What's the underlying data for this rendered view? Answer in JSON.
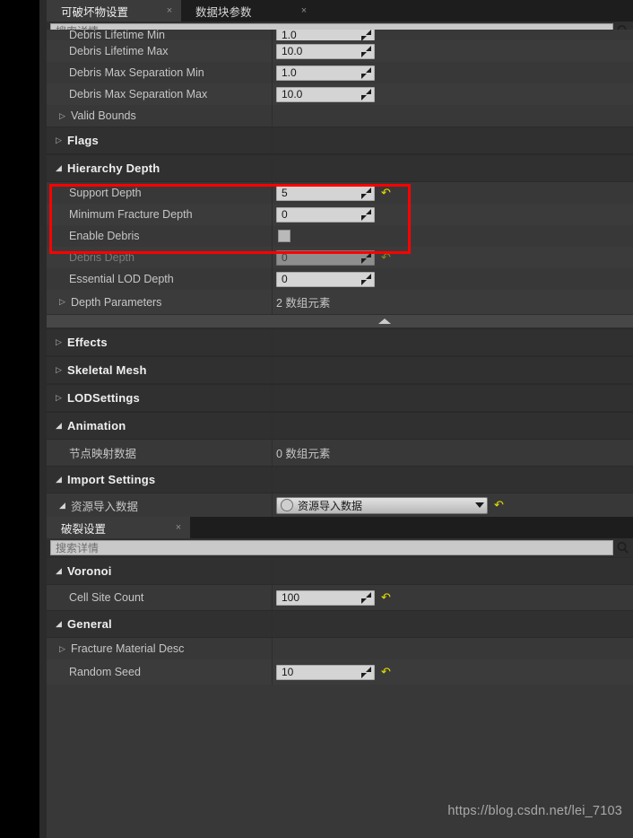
{
  "window": {
    "watermark": "https://blog.csdn.net/lei_7103"
  },
  "top_panel": {
    "tabs": [
      {
        "label": "可破坏物设置",
        "close": "×",
        "active": true
      },
      {
        "label": "数据块参数",
        "close": "×",
        "active": false
      }
    ],
    "search": {
      "placeholder": "搜索详情",
      "value": "",
      "icon": "search-icon"
    },
    "rows": [
      {
        "kind": "property",
        "clipped": true,
        "label": "Debris Lifetime Min",
        "value": "1.0",
        "control": "number",
        "reset": false,
        "disabled": false,
        "indent": true
      },
      {
        "kind": "property",
        "label": "Debris Lifetime Max",
        "value": "10.0",
        "control": "number",
        "reset": false,
        "disabled": false,
        "indent": true
      },
      {
        "kind": "property",
        "label": "Debris Max Separation Min",
        "value": "1.0",
        "control": "number",
        "reset": false,
        "disabled": false,
        "indent": true
      },
      {
        "kind": "property",
        "label": "Debris Max Separation Max",
        "value": "10.0",
        "control": "number",
        "reset": false,
        "disabled": false,
        "indent": true
      },
      {
        "kind": "expandable",
        "label": "Valid Bounds",
        "expander": "collapsed",
        "value": ""
      },
      {
        "kind": "section",
        "label": "Flags",
        "expander": "collapsed"
      },
      {
        "kind": "section",
        "label": "Hierarchy Depth",
        "expander": "expanded"
      },
      {
        "kind": "property",
        "label": "Support Depth",
        "value": "5",
        "control": "number",
        "reset": true,
        "disabled": false,
        "indent": true
      },
      {
        "kind": "property",
        "label": "Minimum Fracture Depth",
        "value": "0",
        "control": "number",
        "reset": false,
        "disabled": false,
        "indent": true
      },
      {
        "kind": "property",
        "label": "Enable Debris",
        "value": "",
        "control": "checkbox",
        "checked": false,
        "reset": false,
        "disabled": false,
        "indent": true
      },
      {
        "kind": "property",
        "label": "Debris Depth",
        "value": "0",
        "control": "number",
        "reset": true,
        "disabled": true,
        "indent": true
      },
      {
        "kind": "property",
        "label": "Essential LOD Depth",
        "value": "0",
        "control": "number",
        "reset": false,
        "disabled": false,
        "indent": true
      },
      {
        "kind": "expandable",
        "label": "Depth Parameters",
        "expander": "collapsed",
        "value": "2 数组元素"
      },
      {
        "kind": "splitter"
      },
      {
        "kind": "section",
        "label": "Effects",
        "expander": "collapsed"
      },
      {
        "kind": "section",
        "label": "Skeletal Mesh",
        "expander": "collapsed"
      },
      {
        "kind": "section",
        "label": "LODSettings",
        "expander": "collapsed"
      },
      {
        "kind": "section",
        "label": "Animation",
        "expander": "expanded"
      },
      {
        "kind": "property",
        "label": "节点映射数据",
        "value": "0 数组元素",
        "control": "text",
        "reset": false,
        "disabled": false,
        "indent": true
      },
      {
        "kind": "section",
        "label": "Import Settings",
        "expander": "expanded"
      },
      {
        "kind": "combo",
        "label": "资源导入数据",
        "expander": "expanded",
        "value": "资源导入数据",
        "reset": true
      }
    ]
  },
  "bottom_panel": {
    "tabs": [
      {
        "label": "破裂设置",
        "close": "×",
        "active": true
      }
    ],
    "search": {
      "placeholder": "搜索详情",
      "value": "",
      "icon": "search-icon"
    },
    "rows": [
      {
        "kind": "section",
        "label": "Voronoi",
        "expander": "expanded"
      },
      {
        "kind": "property",
        "label": "Cell Site Count",
        "value": "100",
        "control": "number",
        "reset": true,
        "disabled": false,
        "indent": true
      },
      {
        "kind": "section",
        "label": "General",
        "expander": "expanded"
      },
      {
        "kind": "expandable",
        "label": "Fracture Material Desc",
        "expander": "collapsed",
        "value": ""
      },
      {
        "kind": "property",
        "label": "Random Seed",
        "value": "10",
        "control": "number",
        "reset": true,
        "disabled": false,
        "indent": true
      }
    ]
  },
  "annotation": {
    "color": "#ff0000",
    "label": "hierarchy-depth-highlight"
  },
  "glyphs": {
    "expander_collapsed": "▷",
    "expander_expanded": "◢",
    "reset": "↶",
    "search": "⌕"
  }
}
